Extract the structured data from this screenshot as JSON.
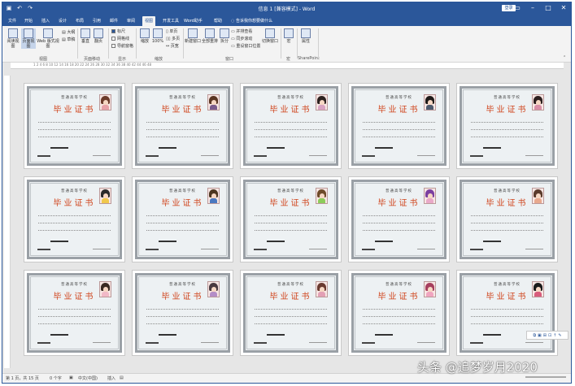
{
  "window": {
    "title": "信息 1 [兼容模式] - Word",
    "signin_label": "登录"
  },
  "qat": [
    {
      "icon": "save-icon",
      "glyph": "▣"
    },
    {
      "icon": "undo-icon",
      "glyph": "↶"
    },
    {
      "icon": "redo-icon",
      "glyph": "↷"
    }
  ],
  "tabs": [
    "文件",
    "开始",
    "插入",
    "设计",
    "布局",
    "引用",
    "邮件",
    "审阅",
    "视图",
    "开发工具",
    "Word助手",
    "帮助",
    "告诉我你想要做什么"
  ],
  "active_tab": "视图",
  "ribbon": {
    "views": {
      "read_mode": "阅读视图",
      "print_layout": "页面视图",
      "web_layout": "Web 版式视图",
      "outline": "大纲",
      "draft": "草稿",
      "group": "视图"
    },
    "page_move": {
      "vertical": "垂直",
      "side_by_side": "翻页",
      "group": "页面移动"
    },
    "show": {
      "ruler": "标尺",
      "gridlines": "网格线",
      "nav_pane": "导航窗格",
      "group": "显示"
    },
    "zoom": {
      "zoom": "缩放",
      "hundred": "100%",
      "one_page": "单页",
      "multi_page": "多页",
      "page_width": "页宽",
      "group": "缩放"
    },
    "window": {
      "new_window": "新建窗口",
      "arrange_all": "全部重排",
      "split": "拆分",
      "side_by_side": "并排查看",
      "sync_scroll": "同步滚动",
      "reset": "重设窗口位置",
      "switch": "切换窗口",
      "group": "窗口"
    },
    "macros": {
      "macros": "宏",
      "group": "宏"
    },
    "sharepoint": {
      "properties": "属性",
      "group": "SharePoint"
    }
  },
  "ruler": {
    "text": "1 2 4 6 8 10 12 14 16 18 20 22 24 26 28 30 32 34 36 38 40 42 44 46 48"
  },
  "certificate": {
    "school": "普通高等学校",
    "heading": "毕业证书",
    "photos": [
      {
        "hair": "#6b3b2a",
        "body": "#e7a2a8"
      },
      {
        "hair": "#5a3523",
        "body": "#7a5b8d"
      },
      {
        "hair": "#2d2220",
        "body": "#d9a4c2"
      },
      {
        "hair": "#1e1a18",
        "body": "#4e5a6e"
      },
      {
        "hair": "#2c1f1e",
        "body": "#d98fa6"
      },
      {
        "hair": "#2b2b2b",
        "body": "#f0c84b"
      },
      {
        "hair": "#4d3620",
        "body": "#4a78c0"
      },
      {
        "hair": "#6e4b2a",
        "body": "#8ccc5a"
      },
      {
        "hair": "#7b3fa0",
        "body": "#e9a9c9"
      },
      {
        "hair": "#5b3b2c",
        "body": "#e8a98e"
      },
      {
        "hair": "#3a2a22",
        "body": "#f1b9c7"
      },
      {
        "hair": "#4a3a40",
        "body": "#b48ec7"
      },
      {
        "hair": "#6a3a30",
        "body": "#e3a0b5"
      },
      {
        "hair": "#a63f5e",
        "body": "#f0a5c0"
      },
      {
        "hair": "#1a1a1a",
        "body": "#d85c7c"
      }
    ]
  },
  "status": {
    "page": "第 1 页，共 15 页",
    "words": "0 个字",
    "lang": "中文(中国)",
    "mode": "插入"
  },
  "float_toolbar": [
    "⧉",
    "▣",
    "⊞",
    "⊡",
    "↑",
    "✎"
  ],
  "watermark": "头条 @追梦岁月2020"
}
